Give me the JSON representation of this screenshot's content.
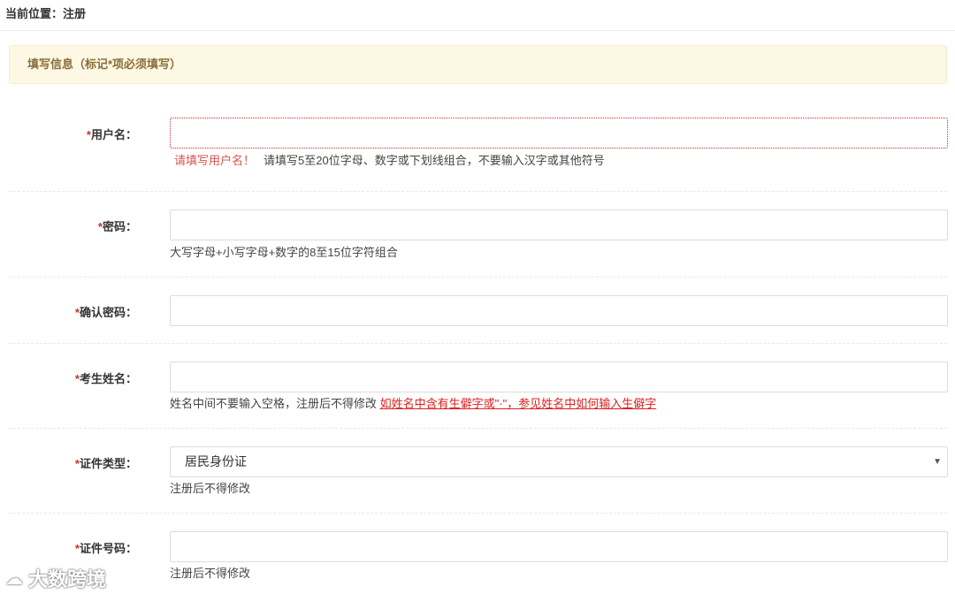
{
  "breadcrumb": "当前位置：注册",
  "notice": "填写信息（标记*项必须填写）",
  "fields": {
    "username": {
      "required_mark": "*",
      "label": "用户名：",
      "value": "",
      "error": "请填写用户名！",
      "help": "请填写5至20位字母、数字或下划线组合，不要输入汉字或其他符号"
    },
    "password": {
      "required_mark": "*",
      "label": "密码：",
      "value": "",
      "help": "大写字母+小写字母+数字的8至15位字符组合"
    },
    "confirm_password": {
      "required_mark": "*",
      "label": "确认密码：",
      "value": ""
    },
    "name": {
      "required_mark": "*",
      "label": "考生姓名：",
      "value": "",
      "help": "姓名中间不要输入空格，注册后不得修改",
      "link": "如姓名中含有生僻字或\"·\"，参见姓名中如何输入生僻字"
    },
    "id_type": {
      "required_mark": "*",
      "label": "证件类型：",
      "selected": "居民身份证",
      "help": "注册后不得修改"
    },
    "id_number": {
      "required_mark": "*",
      "label": "证件号码：",
      "value": "",
      "help": "注册后不得修改"
    }
  },
  "watermark": {
    "icon": "cloud-logo-icon",
    "text": "大数跨境"
  }
}
